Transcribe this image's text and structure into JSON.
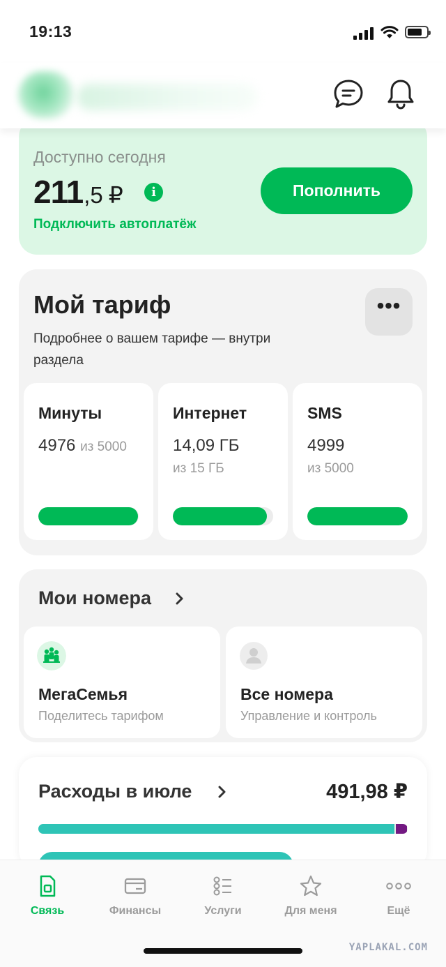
{
  "status_bar": {
    "time": "19:13"
  },
  "header": {
    "chat_icon": "chat-icon",
    "bell_icon": "bell-icon"
  },
  "balance": {
    "label": "Доступно сегодня",
    "amount_int": "211",
    "amount_frac": ",5",
    "currency": "₽",
    "autopay_link": "Подключить автоплатёж",
    "topup_label": "Пополнить"
  },
  "tariff": {
    "title": "Мой тариф",
    "description": "Подробнее о вашем тарифе — внутри раздела",
    "more_label": "•••",
    "minutes": {
      "title": "Минуты",
      "value": "4976",
      "of": "из 5000",
      "fill": 0.995
    },
    "internet": {
      "title": "Интернет",
      "value": "14,09 ГБ",
      "of": "из 15 ГБ",
      "fill": 0.94
    },
    "sms": {
      "title": "SMS",
      "value": "4999",
      "of": "из 5000",
      "fill": 0.9998
    }
  },
  "numbers": {
    "title": "Мои номера",
    "family": {
      "title": "МегаСемья",
      "subtitle": "Поделитесь тарифом"
    },
    "all": {
      "title": "Все номера",
      "subtitle": "Управление и контроль"
    }
  },
  "expenses": {
    "title": "Расходы в июле",
    "total": "491,98 ₽",
    "share_a": 0.965,
    "share_b": 0.03,
    "color_a": "#2ec4b6",
    "color_b": "#731982"
  },
  "tabbar": {
    "tabs": [
      {
        "label": "Связь",
        "icon": "sim-card-icon",
        "active": true
      },
      {
        "label": "Финансы",
        "icon": "wallet-icon",
        "active": false
      },
      {
        "label": "Услуги",
        "icon": "services-list-icon",
        "active": false
      },
      {
        "label": "Для меня",
        "icon": "star-icon",
        "active": false
      },
      {
        "label": "Ещё",
        "icon": "more-dots-icon",
        "active": false
      }
    ]
  },
  "watermark": "YAPLAKAL.COM",
  "colors": {
    "brand_green": "#00b956",
    "balance_bg": "#dcf7e5",
    "card_bg": "#f3f3f3"
  }
}
